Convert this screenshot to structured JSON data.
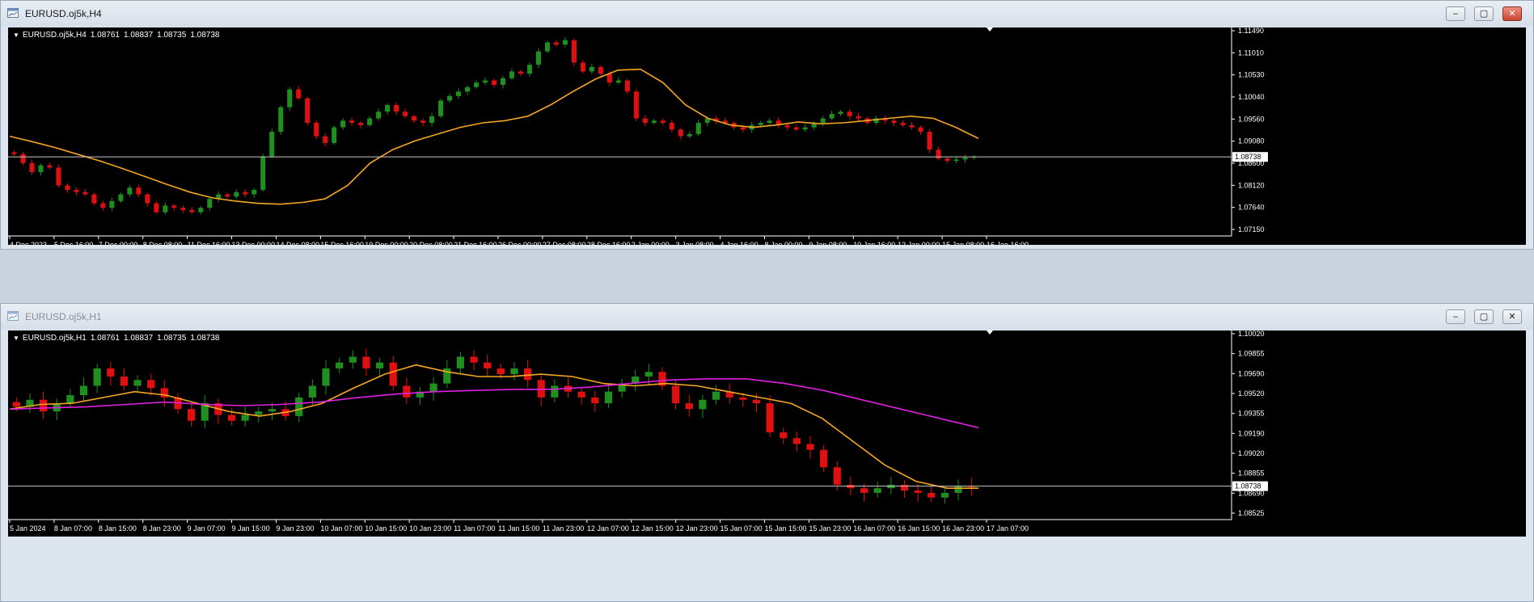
{
  "windows": [
    {
      "title": "EURUSD.oj5k,H4",
      "active": true,
      "symbol_info": {
        "symbol": "EURUSD.oj5k,H4",
        "open": "1.08761",
        "high": "1.08837",
        "low": "1.08735",
        "close": "1.08738"
      },
      "buttons": {
        "minimize": "‒",
        "maximize": "▢",
        "close": "✕"
      },
      "chart_data": {
        "type": "candlestick",
        "ylim": [
          1.0715,
          1.1149
        ],
        "price_ticks": [
          "1.11490",
          "1.11010",
          "1.10530",
          "1.10040",
          "1.09560",
          "1.09080",
          "1.08600",
          "1.08120",
          "1.07640",
          "1.07150"
        ],
        "current_price": "1.08738",
        "time_labels": [
          "4 Dec 2023",
          "5 Dec 16:00",
          "7 Dec 00:00",
          "8 Dec 08:00",
          "11 Dec 16:00",
          "13 Dec 00:00",
          "14 Dec 08:00",
          "15 Dec 16:00",
          "19 Dec 00:00",
          "20 Dec 08:00",
          "21 Dec 16:00",
          "26 Dec 00:00",
          "27 Dec 08:00",
          "28 Dec 16:00",
          "2 Jan 00:00",
          "3 Jan 08:00",
          "4 Jan 16:00",
          "8 Jan 00:00",
          "9 Jan 08:00",
          "10 Jan 16:00",
          "12 Jan 00:00",
          "15 Jan 08:00",
          "16 Jan 16:00"
        ],
        "bull_color": "#1f8f1f",
        "bear_color": "#e01010",
        "series": [
          {
            "name": "close",
            "values": [
              1.088,
              1.086,
              1.084,
              1.0855,
              1.085,
              1.081,
              1.08,
              1.0795,
              1.079,
              1.077,
              1.076,
              1.0775,
              1.079,
              1.0805,
              1.079,
              1.077,
              1.075,
              1.0765,
              1.076,
              1.0755,
              1.075,
              1.076,
              1.078,
              1.079,
              1.0785,
              1.0795,
              1.079,
              1.08,
              1.0875,
              1.093,
              1.0985,
              1.1025,
              1.1005,
              1.095,
              1.092,
              1.0905,
              1.094,
              1.0955,
              1.095,
              1.0945,
              1.096,
              1.0975,
              1.099,
              1.0975,
              1.0965,
              1.0955,
              1.095,
              1.0965,
              1.1,
              1.101,
              1.102,
              1.103,
              1.104,
              1.1045,
              1.1035,
              1.105,
              1.1065,
              1.106,
              1.108,
              1.111,
              1.113,
              1.1125,
              1.1135,
              1.1085,
              1.1065,
              1.1075,
              1.106,
              1.104,
              1.1045,
              1.102,
              1.096,
              1.095,
              1.0955,
              1.095,
              1.0935,
              1.092,
              1.0925,
              1.095,
              1.096,
              1.0955,
              1.095,
              1.094,
              1.0935,
              1.0945,
              1.095,
              1.0955,
              1.0945,
              1.094,
              1.0935,
              1.094,
              1.095,
              1.096,
              1.097,
              1.0975,
              1.0965,
              1.096,
              1.095,
              1.096,
              1.0955,
              1.095,
              1.0945,
              1.094,
              1.093,
              1.089,
              1.087,
              1.0865,
              1.0868,
              1.0872,
              1.0874
            ]
          },
          {
            "name": "moving_average",
            "values": [
              1.092,
              1.0908,
              1.0895,
              1.088,
              1.0865,
              1.0848,
              1.083,
              1.0812,
              1.0795,
              1.0782,
              1.0775,
              1.077,
              1.0768,
              1.0772,
              1.078,
              1.081,
              1.086,
              1.089,
              1.091,
              1.0925,
              1.094,
              1.095,
              1.0955,
              1.0965,
              1.099,
              1.102,
              1.1048,
              1.1068,
              1.107,
              1.104,
              1.099,
              1.096,
              1.0945,
              1.094,
              1.0945,
              1.0952,
              1.0948,
              1.095,
              1.0955,
              1.096,
              1.0965,
              1.096,
              1.094,
              1.0915
            ]
          }
        ]
      }
    },
    {
      "title": "EURUSD.oj5k,H1",
      "active": false,
      "symbol_info": {
        "symbol": "EURUSD.oj5k,H1",
        "open": "1.08761",
        "high": "1.08837",
        "low": "1.08735",
        "close": "1.08738"
      },
      "buttons": {
        "minimize": "‒",
        "maximize": "▢",
        "close": "✕"
      },
      "chart_data": {
        "type": "candlestick",
        "ylim": [
          1.0852,
          1.1002
        ],
        "price_ticks": [
          "1.10020",
          "1.09855",
          "1.09690",
          "1.09520",
          "1.09355",
          "1.09190",
          "1.09020",
          "1.08855",
          "1.08690",
          "1.08525"
        ],
        "current_price": "1.08738",
        "time_labels": [
          "5 Jan 2024",
          "8 Jan 07:00",
          "8 Jan 15:00",
          "8 Jan 23:00",
          "9 Jan 07:00",
          "9 Jan 15:00",
          "9 Jan 23:00",
          "10 Jan 07:00",
          "10 Jan 15:00",
          "10 Jan 23:00",
          "11 Jan 07:00",
          "11 Jan 15:00",
          "11 Jan 23:00",
          "12 Jan 07:00",
          "12 Jan 15:00",
          "12 Jan 23:00",
          "15 Jan 07:00",
          "15 Jan 15:00",
          "15 Jan 23:00",
          "16 Jan 07:00",
          "16 Jan 15:00",
          "16 Jan 23:00",
          "17 Jan 07:00"
        ],
        "bull_color": "#1f8f1f",
        "bear_color": "#e01010",
        "series": [
          {
            "name": "close",
            "values": [
              1.0942,
              1.0948,
              1.0938,
              1.0945,
              1.0952,
              1.096,
              1.0975,
              1.0968,
              1.096,
              1.0965,
              1.0958,
              1.095,
              1.094,
              1.093,
              1.0945,
              1.0935,
              1.093,
              1.0935,
              1.0938,
              1.094,
              1.0934,
              1.095,
              1.096,
              1.0975,
              1.098,
              1.0985,
              1.0975,
              1.098,
              1.096,
              1.095,
              1.0955,
              1.0962,
              1.0975,
              1.0985,
              1.098,
              1.0975,
              1.097,
              1.0975,
              1.0965,
              1.095,
              1.096,
              1.0955,
              1.095,
              1.0945,
              1.0955,
              1.0962,
              1.0968,
              1.0972,
              1.096,
              1.0945,
              1.094,
              1.0948,
              1.0955,
              1.095,
              1.0948,
              1.0945,
              1.092,
              1.0915,
              1.091,
              1.0905,
              1.089,
              1.0875,
              1.0872,
              1.0868,
              1.0872,
              1.0875,
              1.087,
              1.0868,
              1.0864,
              1.0868,
              1.0874,
              1.0873
            ]
          },
          {
            "name": "moving_average_fast",
            "values": [
              1.094,
              1.0944,
              1.0945,
              1.095,
              1.0955,
              1.0952,
              1.0945,
              1.0938,
              1.0934,
              1.0938,
              1.0945,
              1.0958,
              1.097,
              1.0978,
              1.0972,
              1.0968,
              1.0968,
              1.097,
              1.0968,
              1.0962,
              1.096,
              1.0962,
              1.096,
              1.0955,
              1.095,
              1.0945,
              1.0932,
              1.0912,
              1.0892,
              1.0878,
              1.0872,
              1.0872
            ]
          },
          {
            "name": "moving_average_slow",
            "values": [
              1.094,
              1.0941,
              1.0942,
              1.0944,
              1.0946,
              1.0944,
              1.0943,
              1.0944,
              1.0946,
              1.095,
              1.0953,
              1.0955,
              1.0956,
              1.0957,
              1.0957,
              1.0959,
              1.0962,
              1.0965,
              1.0966,
              1.0966,
              1.0962,
              1.0956,
              1.0948,
              1.094,
              1.0932,
              1.0924
            ]
          }
        ]
      }
    }
  ]
}
